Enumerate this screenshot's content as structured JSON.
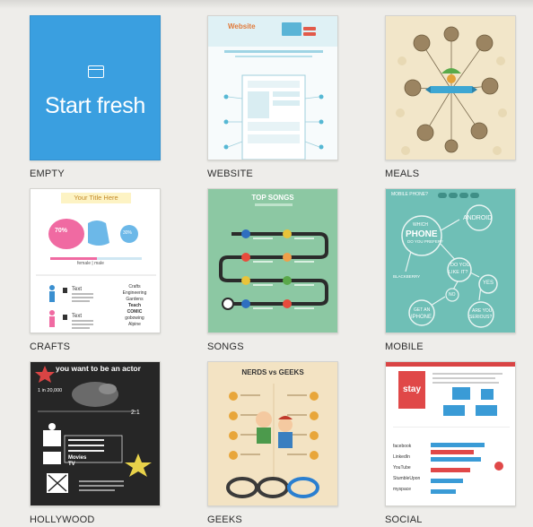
{
  "templates": [
    {
      "id": "empty",
      "label": "EMPTY",
      "thumb_text": "Start fresh"
    },
    {
      "id": "website",
      "label": "WEBSITE",
      "thumb_text": "Website"
    },
    {
      "id": "meals",
      "label": "MEALS"
    },
    {
      "id": "crafts",
      "label": "CRAFTS",
      "thumb_text": "Your Title Here",
      "thumb_percent": "70%",
      "thumb_percent2": "30%",
      "thumb_legend": "female | male",
      "thumb_item1": "Text",
      "thumb_item2": "Text",
      "thumb_words": [
        "Crafts",
        "Engineering",
        "Gardens",
        "Teach",
        "COMIC",
        "gobowing",
        "Alpine"
      ]
    },
    {
      "id": "songs",
      "label": "SONGS",
      "thumb_text": "TOP SONGS"
    },
    {
      "id": "mobile",
      "label": "MOBILE",
      "thumb_words": [
        "MOBILE PHONE?",
        "ANDROID",
        "WHICH",
        "PHONE",
        "DO YOU PREFER?",
        "DO YOU",
        "LIKE IT?",
        "BLACKBERRY",
        "YES",
        "NO",
        "GET AN",
        "IPHONE",
        "ARE YOU",
        "SERIOUS?"
      ]
    },
    {
      "id": "hollywood",
      "label": "HOLLYWOOD",
      "thumb_text": "you want to be an actor",
      "thumb_stat": "1 in 20,000",
      "thumb_ratio": "2:1",
      "thumb_words": [
        "Movies",
        "TV"
      ]
    },
    {
      "id": "geeks",
      "label": "GEEKS",
      "thumb_text": "NERDS vs GEEKS"
    },
    {
      "id": "social",
      "label": "SOCIAL",
      "thumb_text": "stay",
      "thumb_rows": [
        "facebook",
        "LinkedIn",
        "YouTube",
        "StumbleUpon",
        "myspace"
      ]
    }
  ],
  "colors": {
    "empty_bg": "#3a9fe0",
    "page_bg": "#eeedea"
  }
}
